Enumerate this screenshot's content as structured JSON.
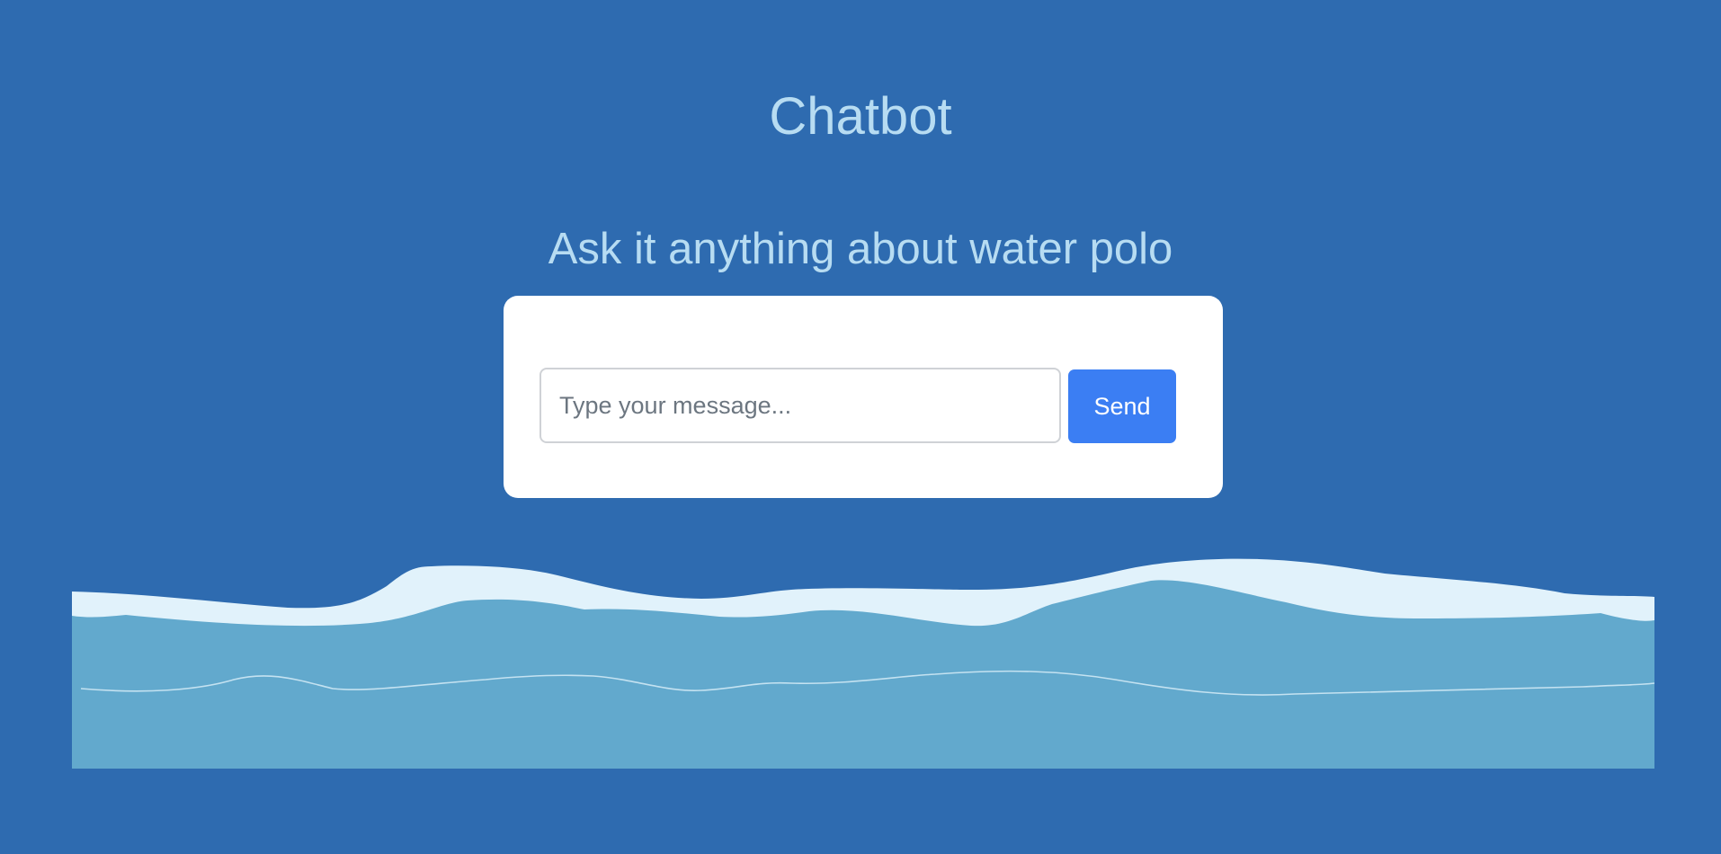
{
  "header": {
    "title": "Chatbot",
    "subtitle": "Ask it anything about water polo"
  },
  "chat": {
    "input_value": "",
    "input_placeholder": "Type your message...",
    "send_label": "Send"
  },
  "colors": {
    "background": "#2e6bb0",
    "heading_text": "#b7dcf2",
    "send_button": "#3b7ef3",
    "water": "#62a9cd",
    "foam": "#e1f2fb"
  }
}
